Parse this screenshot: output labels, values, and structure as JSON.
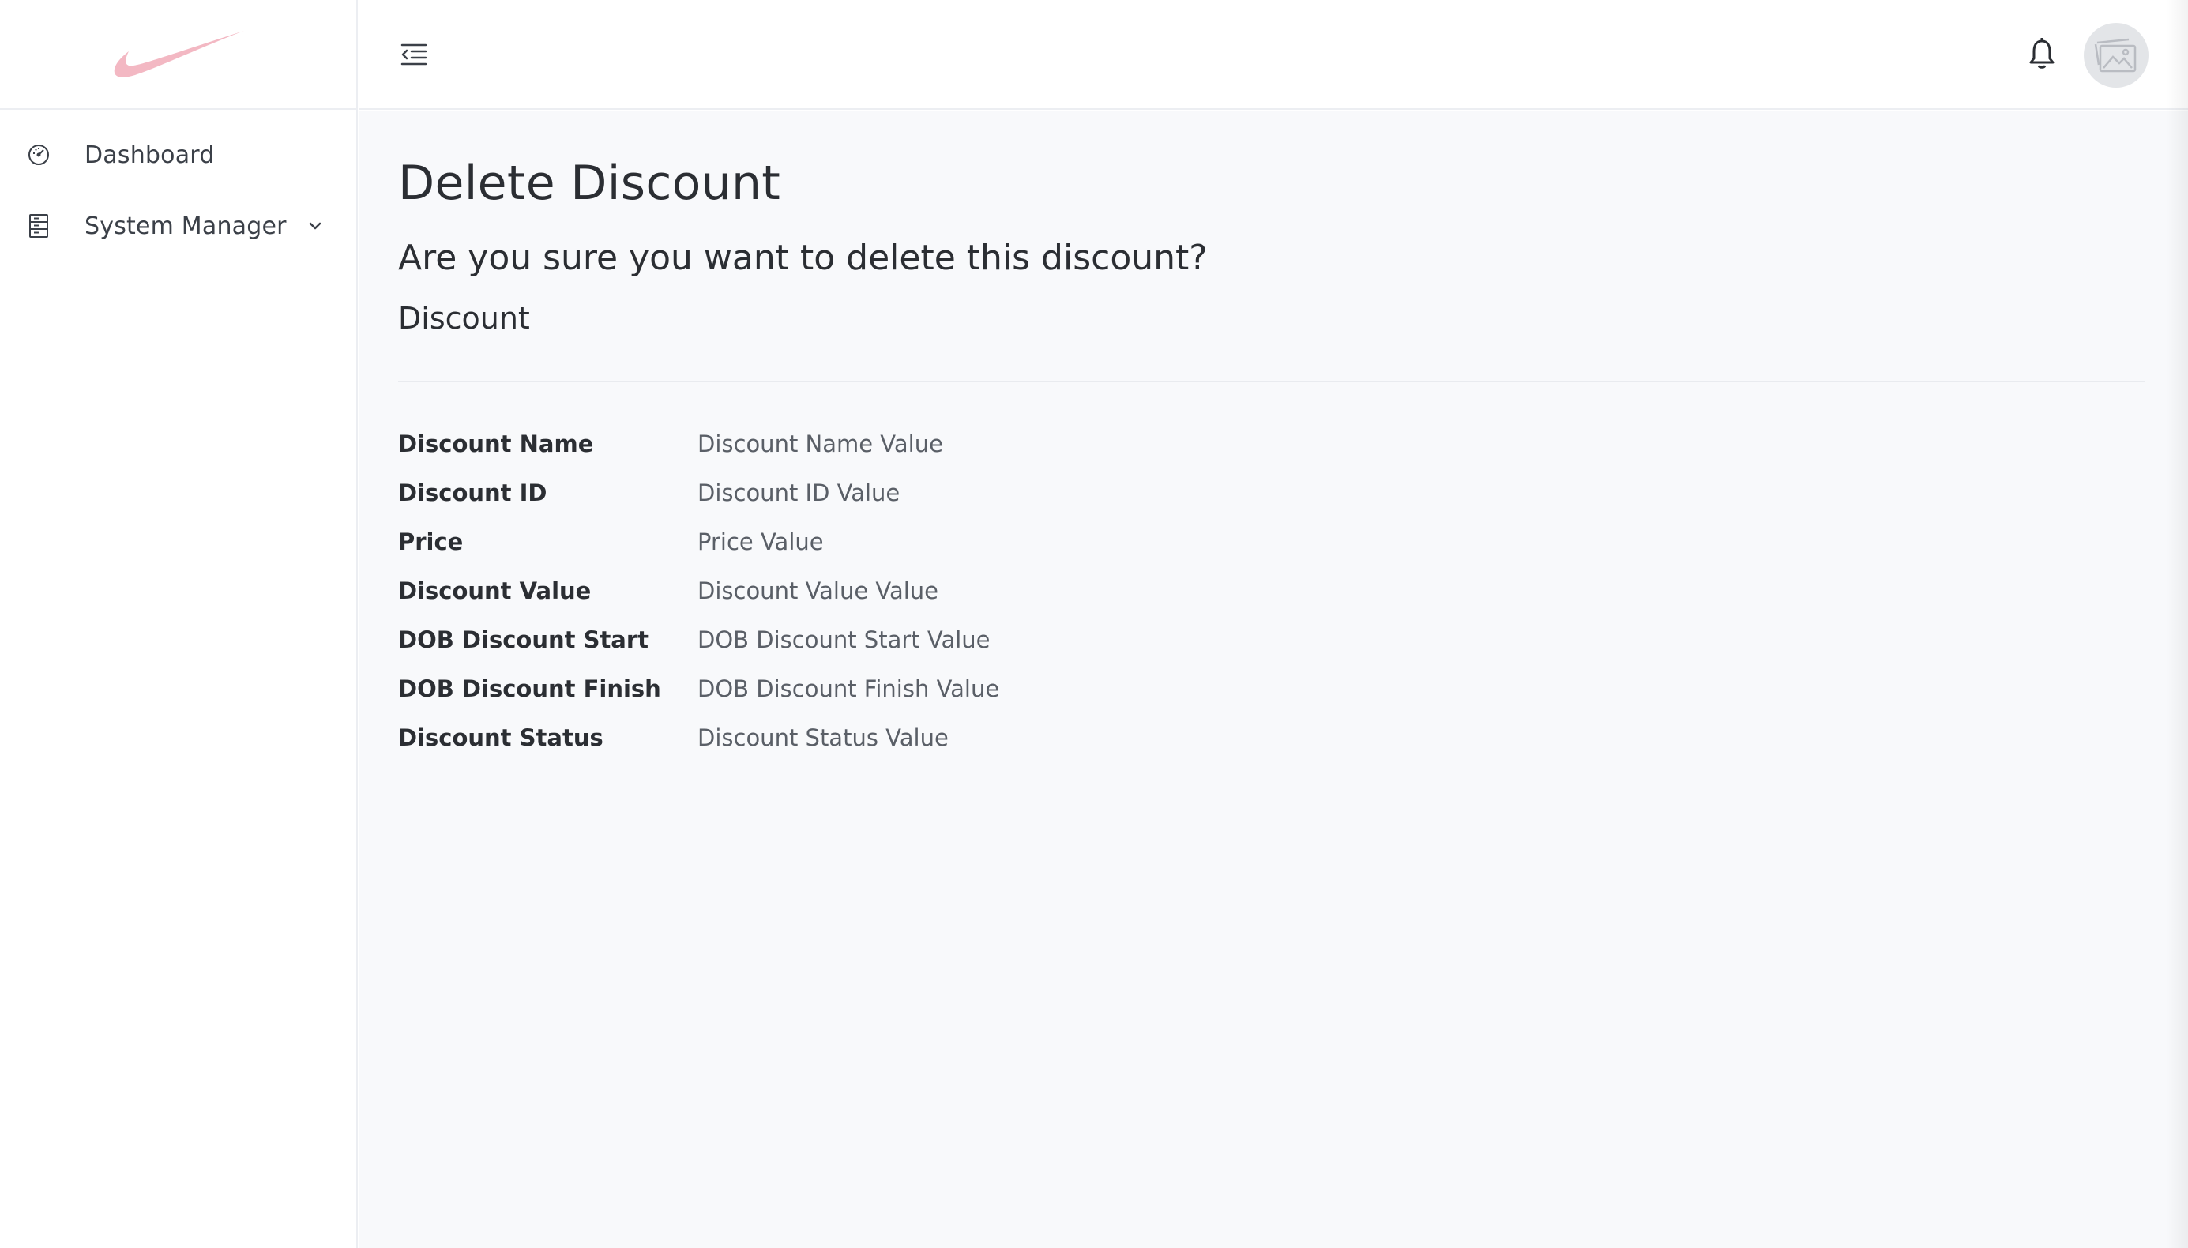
{
  "sidebar": {
    "brand_logo": "swoosh-logo",
    "brand_color": "#f3b8c3",
    "items": [
      {
        "label": "Dashboard",
        "icon": "speedometer-icon"
      },
      {
        "label": "System Manager",
        "icon": "cabinet-icon",
        "expandable": true
      }
    ]
  },
  "topbar": {
    "menu_icon": "menu-collapse-icon",
    "notification_icon": "bell-icon",
    "avatar_icon": "image-placeholder-icon"
  },
  "page": {
    "title": "Delete Discount",
    "confirm_question": "Are you sure you want to delete this discount?",
    "section_title": "Discount",
    "details": [
      {
        "label": "Discount Name",
        "value": "Discount Name Value"
      },
      {
        "label": "Discount ID",
        "value": "Discount ID Value"
      },
      {
        "label": "Price",
        "value": "Price Value"
      },
      {
        "label": "Discount Value",
        "value": "Discount Value Value"
      },
      {
        "label": "DOB Discount Start",
        "value": "DOB Discount Start Value"
      },
      {
        "label": "DOB Discount Finish",
        "value": "DOB Discount Finish Value"
      },
      {
        "label": "Discount Status",
        "value": "Discount Status Value"
      }
    ]
  }
}
